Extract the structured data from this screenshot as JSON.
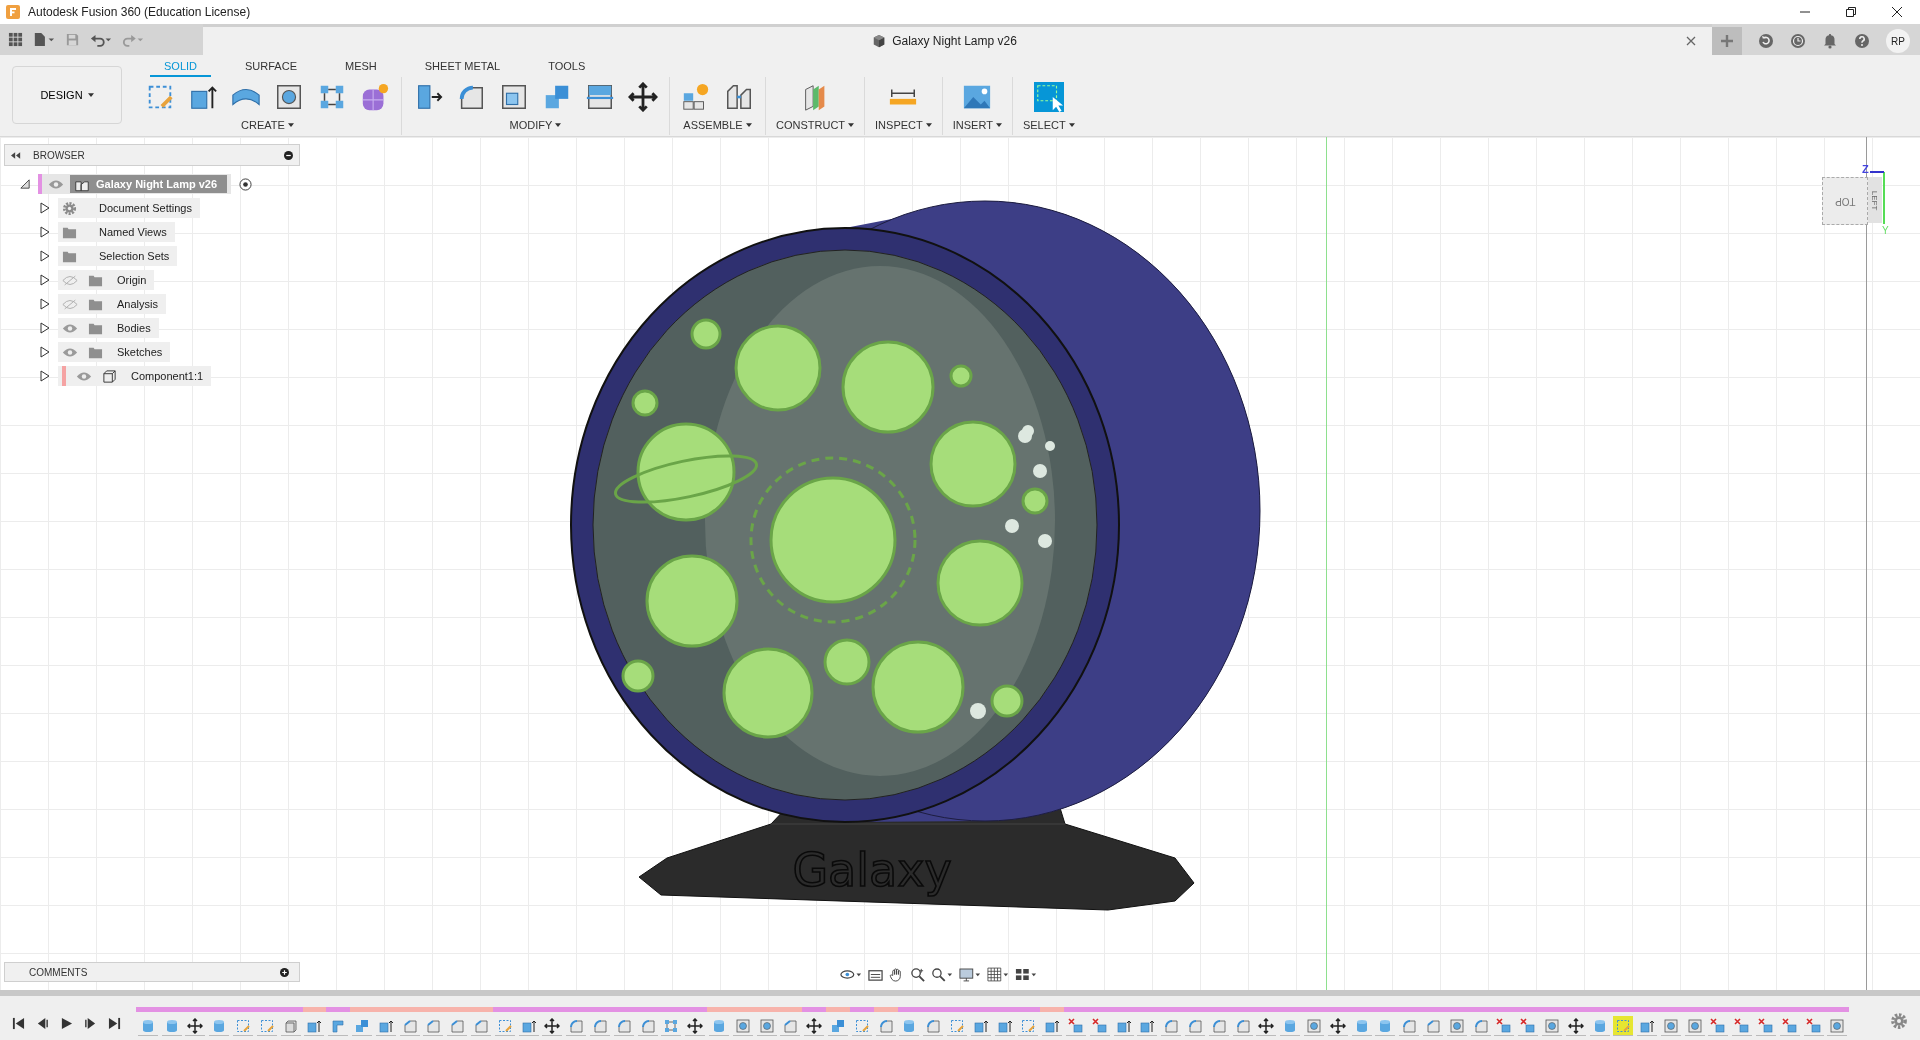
{
  "app": {
    "title": "Autodesk Fusion 360 (Education License)"
  },
  "document": {
    "title": "Galaxy Night Lamp v26"
  },
  "user": {
    "initials": "RP"
  },
  "workspace": {
    "label": "DESIGN"
  },
  "tabs": [
    {
      "label": "SOLID",
      "selected": true
    },
    {
      "label": "SURFACE",
      "selected": false
    },
    {
      "label": "MESH",
      "selected": false
    },
    {
      "label": "SHEET METAL",
      "selected": false
    },
    {
      "label": "TOOLS",
      "selected": false
    }
  ],
  "groups": [
    {
      "label": "CREATE",
      "tools": [
        {
          "kind": "sketch"
        },
        {
          "kind": "extrude"
        },
        {
          "kind": "revolve"
        },
        {
          "kind": "hole"
        },
        {
          "kind": "pattern"
        },
        {
          "kind": "form"
        }
      ]
    },
    {
      "label": "MODIFY",
      "tools": [
        {
          "kind": "presspull"
        },
        {
          "kind": "fillet"
        },
        {
          "kind": "shell"
        },
        {
          "kind": "combine"
        },
        {
          "kind": "split"
        },
        {
          "kind": "move"
        }
      ]
    },
    {
      "label": "ASSEMBLE",
      "tools": [
        {
          "kind": "newcomponent"
        },
        {
          "kind": "joint"
        }
      ]
    },
    {
      "label": "CONSTRUCT",
      "tools": [
        {
          "kind": "plane"
        }
      ]
    },
    {
      "label": "INSPECT",
      "tools": [
        {
          "kind": "measure"
        }
      ]
    },
    {
      "label": "INSERT",
      "tools": [
        {
          "kind": "image"
        }
      ]
    },
    {
      "label": "SELECT",
      "tools": [
        {
          "kind": "select"
        }
      ]
    }
  ],
  "browser": {
    "title": "BROWSER",
    "root": {
      "name": "Galaxy Night Lamp v26",
      "eye": true,
      "visible": true,
      "color": "#e391e3"
    },
    "items": [
      {
        "name": "Document Settings",
        "kind": "settings",
        "eye": false
      },
      {
        "name": "Named Views",
        "kind": "folder",
        "eye": false
      },
      {
        "name": "Selection Sets",
        "kind": "folder",
        "eye": false
      },
      {
        "name": "Origin",
        "kind": "folder",
        "eye": true,
        "visible": false
      },
      {
        "name": "Analysis",
        "kind": "folder",
        "eye": true,
        "visible": false
      },
      {
        "name": "Bodies",
        "kind": "folder",
        "eye": true,
        "visible": true
      },
      {
        "name": "Sketches",
        "kind": "folder",
        "eye": true,
        "visible": true
      },
      {
        "name": "Component1:1",
        "kind": "component",
        "eye": true,
        "visible": true,
        "color": "#f5a3a3"
      }
    ]
  },
  "comments": {
    "title": "COMMENTS"
  },
  "viewcube": {
    "face": "TOP",
    "side": "LEFT",
    "axes": [
      "Z",
      "Y"
    ]
  },
  "model": {
    "engraving": "Galaxy"
  },
  "timeline": [
    {
      "kind": "body",
      "color": "#e391e3",
      "selected": false
    },
    {
      "kind": "body",
      "color": "#e391e3",
      "selected": false
    },
    {
      "kind": "move",
      "color": "#e391e3",
      "selected": false
    },
    {
      "kind": "body",
      "color": "#e391e3",
      "selected": false
    },
    {
      "kind": "sketch",
      "color": "#e391e3",
      "selected": false
    },
    {
      "kind": "sketch",
      "color": "#e391e3",
      "selected": false
    },
    {
      "kind": "box",
      "color": "#e391e3",
      "selected": false
    },
    {
      "kind": "extrude",
      "color": "#f7b3ab",
      "selected": false
    },
    {
      "kind": "flange",
      "color": "#e391e3",
      "selected": false
    },
    {
      "kind": "combine",
      "color": "#f7b3ab",
      "selected": false
    },
    {
      "kind": "extrude",
      "color": "#f7b3ab",
      "selected": false
    },
    {
      "kind": "chamfer",
      "color": "#f7b3ab",
      "selected": false
    },
    {
      "kind": "chamfer",
      "color": "#f7b3ab",
      "selected": false
    },
    {
      "kind": "chamfer",
      "color": "#f7b3ab",
      "selected": false
    },
    {
      "kind": "chamfer",
      "color": "#f7b3ab",
      "selected": false
    },
    {
      "kind": "sketch",
      "color": "#e391e3",
      "selected": false
    },
    {
      "kind": "extrude",
      "color": "#e391e3",
      "selected": false
    },
    {
      "kind": "move",
      "color": "#e391e3",
      "selected": false
    },
    {
      "kind": "fillet",
      "color": "#e391e3",
      "selected": false
    },
    {
      "kind": "fillet",
      "color": "#e391e3",
      "selected": false
    },
    {
      "kind": "fillet",
      "color": "#e391e3",
      "selected": false
    },
    {
      "kind": "fillet",
      "color": "#e391e3",
      "selected": false
    },
    {
      "kind": "pattern",
      "color": "#e391e3",
      "selected": false
    },
    {
      "kind": "move",
      "color": "#e391e3",
      "selected": false
    },
    {
      "kind": "body",
      "color": "#f7b3ab",
      "selected": false
    },
    {
      "kind": "hole",
      "color": "#f7b3ab",
      "selected": false
    },
    {
      "kind": "hole",
      "color": "#f7b3ab",
      "selected": false
    },
    {
      "kind": "chamfer",
      "color": "#f7b3ab",
      "selected": false
    },
    {
      "kind": "move",
      "color": "#e391e3",
      "selected": false
    },
    {
      "kind": "combine",
      "color": "#f7b3ab",
      "selected": false
    },
    {
      "kind": "sketch",
      "color": "#e391e3",
      "selected": false
    },
    {
      "kind": "fillet",
      "color": "#f7b3ab",
      "selected": false
    },
    {
      "kind": "body",
      "color": "#e391e3",
      "selected": false
    },
    {
      "kind": "fillet",
      "color": "#e391e3",
      "selected": false
    },
    {
      "kind": "sketch",
      "color": "#e391e3",
      "selected": false
    },
    {
      "kind": "extrude",
      "color": "#e391e3",
      "selected": false
    },
    {
      "kind": "extrude",
      "color": "#e391e3",
      "selected": false
    },
    {
      "kind": "sketch",
      "color": "#e391e3",
      "selected": false
    },
    {
      "kind": "extrude",
      "color": "#f7b3ab",
      "selected": false
    },
    {
      "kind": "delete",
      "color": "#e391e3",
      "selected": false
    },
    {
      "kind": "delete",
      "color": "#e391e3",
      "selected": false
    },
    {
      "kind": "extrude",
      "color": "#e391e3",
      "selected": false
    },
    {
      "kind": "extrude",
      "color": "#e391e3",
      "selected": false
    },
    {
      "kind": "fillet",
      "color": "#e391e3",
      "selected": false
    },
    {
      "kind": "fillet",
      "color": "#e391e3",
      "selected": false
    },
    {
      "kind": "fillet",
      "color": "#e391e3",
      "selected": false
    },
    {
      "kind": "fillet",
      "color": "#e391e3",
      "selected": false
    },
    {
      "kind": "move",
      "color": "#e391e3",
      "selected": false
    },
    {
      "kind": "body",
      "color": "#e391e3",
      "selected": false
    },
    {
      "kind": "hole",
      "color": "#e391e3",
      "selected": false
    },
    {
      "kind": "move",
      "color": "#e391e3",
      "selected": false
    },
    {
      "kind": "body",
      "color": "#e391e3",
      "selected": false
    },
    {
      "kind": "body",
      "color": "#e391e3",
      "selected": false
    },
    {
      "kind": "fillet",
      "color": "#e391e3",
      "selected": false
    },
    {
      "kind": "chamfer",
      "color": "#e391e3",
      "selected": false
    },
    {
      "kind": "hole",
      "color": "#e391e3",
      "selected": false
    },
    {
      "kind": "fillet",
      "color": "#e391e3",
      "selected": false
    },
    {
      "kind": "delete",
      "color": "#e391e3",
      "selected": false
    },
    {
      "kind": "delete",
      "color": "#e391e3",
      "selected": false
    },
    {
      "kind": "hole",
      "color": "#e391e3",
      "selected": false
    },
    {
      "kind": "move",
      "color": "#e391e3",
      "selected": false
    },
    {
      "kind": "body",
      "color": "#e391e3",
      "selected": false
    },
    {
      "kind": "sketch",
      "color": "#e391e3",
      "selected": true
    },
    {
      "kind": "extrude",
      "color": "#e391e3",
      "selected": false
    },
    {
      "kind": "hole",
      "color": "#e391e3",
      "selected": false
    },
    {
      "kind": "hole",
      "color": "#e391e3",
      "selected": false
    },
    {
      "kind": "delete",
      "color": "#e391e3",
      "selected": false
    },
    {
      "kind": "delete",
      "color": "#e391e3",
      "selected": false
    },
    {
      "kind": "delete",
      "color": "#e391e3",
      "selected": false
    },
    {
      "kind": "delete",
      "color": "#e391e3",
      "selected": false
    },
    {
      "kind": "delete",
      "color": "#e391e3",
      "selected": false
    },
    {
      "kind": "hole",
      "color": "#e391e3",
      "selected": false
    }
  ]
}
